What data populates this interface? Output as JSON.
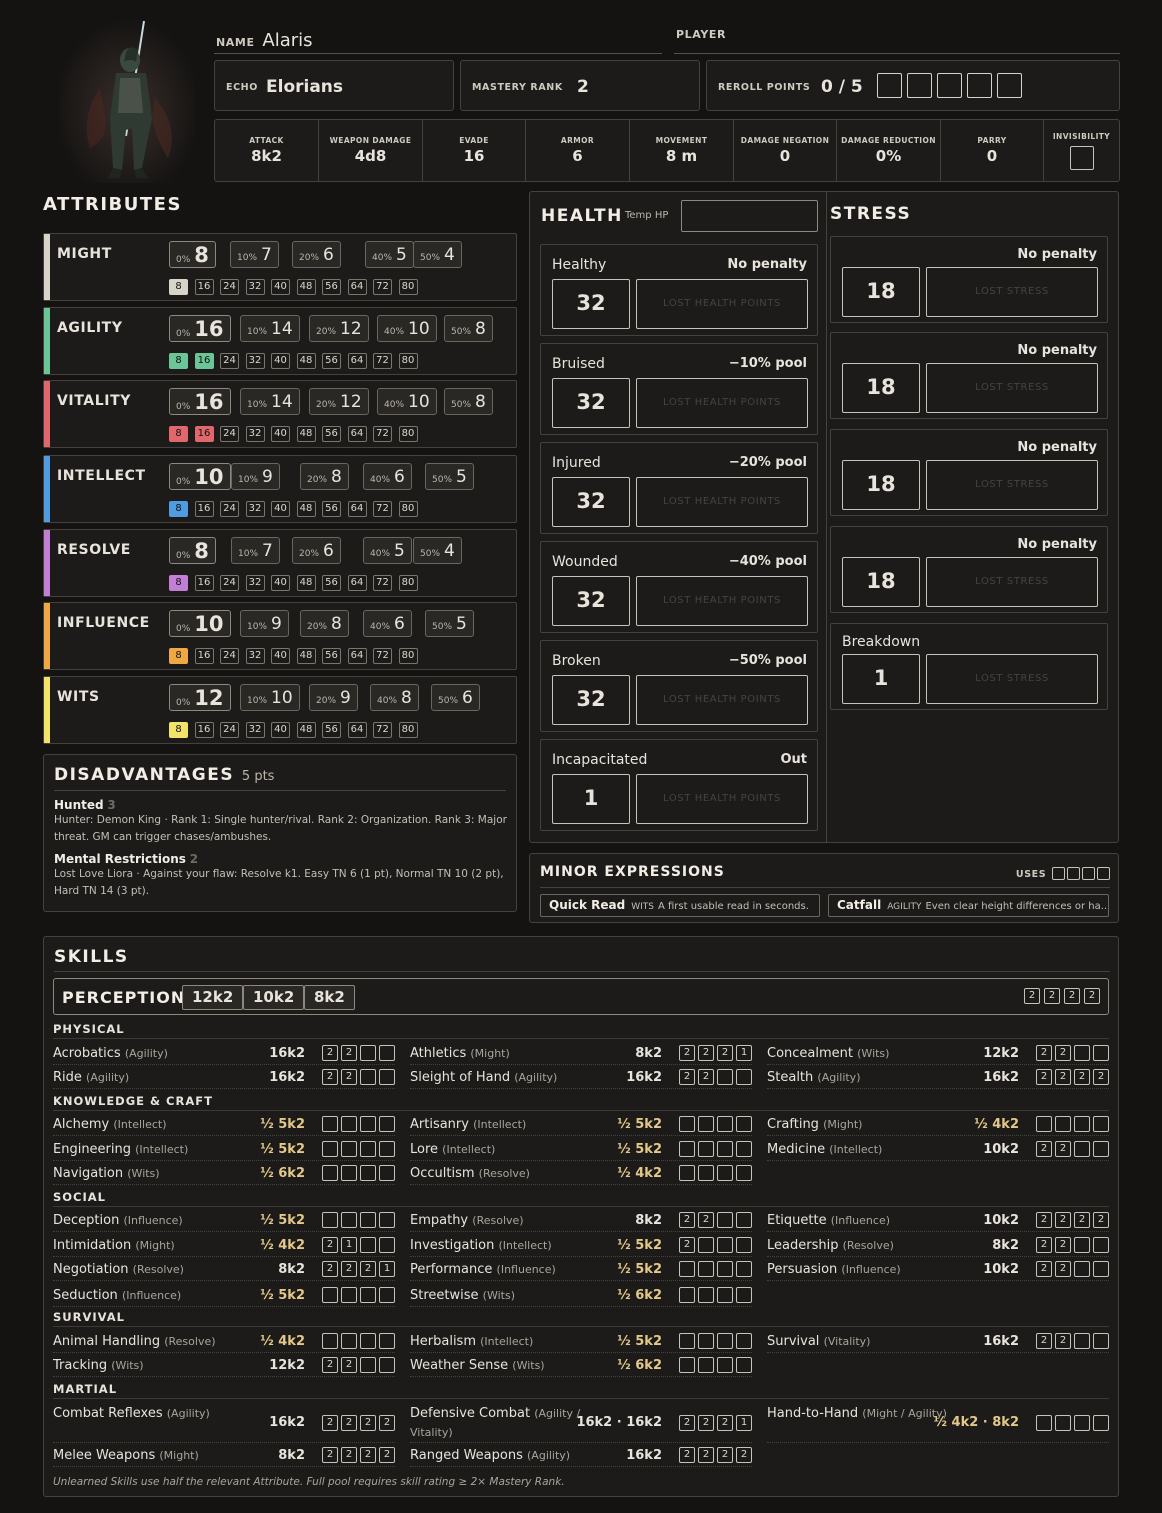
{
  "header": {
    "name_label": "NAME",
    "name": "Alaris",
    "player_label": "PLAYER",
    "player": "",
    "echo_label": "ECHO",
    "echo": "Elorians",
    "mastery_label": "MASTERY RANK",
    "mastery": "2",
    "reroll_label": "REROLL POINTS",
    "reroll": "0 / 5"
  },
  "stats": [
    {
      "label": "ATTACK",
      "value": "8k2"
    },
    {
      "label": "WEAPON DAMAGE",
      "value": "4d8"
    },
    {
      "label": "EVADE",
      "value": "16"
    },
    {
      "label": "ARMOR",
      "value": "6"
    },
    {
      "label": "MOVEMENT",
      "value": "8 m"
    },
    {
      "label": "DAMAGE NEGATION",
      "value": "0"
    },
    {
      "label": "DAMAGE REDUCTION",
      "value": "0%"
    },
    {
      "label": "PARRY",
      "value": "0"
    },
    {
      "label": "INVISIBILITY",
      "value": ""
    }
  ],
  "attributes_title": "ATTRIBUTES",
  "percent_labels": [
    "0%",
    "10%",
    "20%",
    "40%",
    "50%"
  ],
  "track": [
    "8",
    "16",
    "24",
    "32",
    "40",
    "48",
    "56",
    "64",
    "72",
    "80"
  ],
  "attributes": [
    {
      "name": "MIGHT",
      "color": "#d9d4c9",
      "values": [
        "8",
        "7",
        "6",
        "5",
        "4"
      ],
      "filled": 1
    },
    {
      "name": "AGILITY",
      "color": "#6cc596",
      "values": [
        "16",
        "14",
        "12",
        "10",
        "8"
      ],
      "filled": 2
    },
    {
      "name": "VITALITY",
      "color": "#e0676b",
      "values": [
        "16",
        "14",
        "12",
        "10",
        "8"
      ],
      "filled": 2
    },
    {
      "name": "INTELLECT",
      "color": "#4f9de0",
      "values": [
        "10",
        "9",
        "8",
        "6",
        "5"
      ],
      "filled": 1
    },
    {
      "name": "RESOLVE",
      "color": "#c37fd6",
      "values": [
        "8",
        "7",
        "6",
        "5",
        "4"
      ],
      "filled": 1
    },
    {
      "name": "INFLUENCE",
      "color": "#f0a845",
      "values": [
        "10",
        "9",
        "8",
        "6",
        "5"
      ],
      "filled": 1
    },
    {
      "name": "WITS",
      "color": "#f2e36a",
      "values": [
        "12",
        "10",
        "9",
        "8",
        "6"
      ],
      "filled": 1
    }
  ],
  "disadvantages": {
    "title": "DISADVANTAGES",
    "pts": "5 pts",
    "items": [
      {
        "name": "Hunted",
        "rank": "3",
        "desc": "Hunter: Demon King · Rank 1: Single hunter/rival. Rank 2: Organization. Rank 3: Major threat. GM can trigger chases/ambushes."
      },
      {
        "name": "Mental Restrictions",
        "rank": "2",
        "desc": "Lost Love Liora · Against your flaw: Resolve k1. Easy TN 6 (1 pt), Normal TN 10 (2 pt), Hard TN 14 (3 pt)."
      }
    ]
  },
  "health": {
    "title": "HEALTH",
    "temp_label": "Temp HP",
    "temp": "",
    "lost_label": "LOST HEALTH POINTS",
    "levels": [
      {
        "name": "Healthy",
        "penalty": "No penalty",
        "value": "32"
      },
      {
        "name": "Bruised",
        "penalty": "−10% pool",
        "value": "32"
      },
      {
        "name": "Injured",
        "penalty": "−20% pool",
        "value": "32"
      },
      {
        "name": "Wounded",
        "penalty": "−40% pool",
        "value": "32"
      },
      {
        "name": "Broken",
        "penalty": "−50% pool",
        "value": "32"
      },
      {
        "name": "Incapacitated",
        "penalty": "Out",
        "value": "1"
      }
    ]
  },
  "stress": {
    "title": "STRESS",
    "lost_label": "LOST STRESS",
    "levels": [
      {
        "name": "",
        "penalty": "No penalty",
        "value": "18"
      },
      {
        "name": "",
        "penalty": "No penalty",
        "value": "18"
      },
      {
        "name": "",
        "penalty": "No penalty",
        "value": "18"
      },
      {
        "name": "",
        "penalty": "No penalty",
        "value": "18"
      },
      {
        "name": "Breakdown",
        "penalty": "",
        "value": "1"
      }
    ]
  },
  "minor": {
    "title": "MINOR EXPRESSIONS",
    "uses_label": "USES",
    "items": [
      {
        "name": "Quick Read",
        "attr": "WITS",
        "desc": "A first usable read in seconds."
      },
      {
        "name": "Catfall",
        "attr": "AGILITY",
        "desc": "Even clear height differences or ha..."
      }
    ]
  },
  "skills": {
    "title": "SKILLS",
    "perception": {
      "label": "PERCEPTION",
      "pools": [
        "12k2",
        "10k2",
        "8k2"
      ],
      "ranks": [
        "2",
        "2",
        "2",
        "2"
      ]
    },
    "categories": [
      {
        "name": "PHYSICAL",
        "rows": [
          [
            {
              "name": "Acrobatics",
              "attr": "(Agility)",
              "pool": "16k2",
              "ranks": [
                "2",
                "2",
                "",
                ""
              ]
            },
            {
              "name": "Athletics",
              "attr": "(Might)",
              "pool": "8k2",
              "ranks": [
                "2",
                "2",
                "2",
                "1"
              ]
            },
            {
              "name": "Concealment",
              "attr": "(Wits)",
              "pool": "12k2",
              "ranks": [
                "2",
                "2",
                "",
                ""
              ]
            }
          ],
          [
            {
              "name": "Ride",
              "attr": "(Agility)",
              "pool": "16k2",
              "ranks": [
                "2",
                "2",
                "",
                ""
              ]
            },
            {
              "name": "Sleight of Hand",
              "attr": "(Agility)",
              "pool": "16k2",
              "ranks": [
                "2",
                "2",
                "",
                ""
              ]
            },
            {
              "name": "Stealth",
              "attr": "(Agility)",
              "pool": "16k2",
              "ranks": [
                "2",
                "2",
                "2",
                "2"
              ]
            }
          ]
        ]
      },
      {
        "name": "KNOWLEDGE & CRAFT",
        "rows": [
          [
            {
              "name": "Alchemy",
              "attr": "(Intellect)",
              "pool": "½ 5k2",
              "ranks": [
                "",
                "",
                "",
                ""
              ]
            },
            {
              "name": "Artisanry",
              "attr": "(Intellect)",
              "pool": "½ 5k2",
              "ranks": [
                "",
                "",
                "",
                ""
              ]
            },
            {
              "name": "Crafting",
              "attr": "(Might)",
              "pool": "½ 4k2",
              "ranks": [
                "",
                "",
                "",
                ""
              ]
            }
          ],
          [
            {
              "name": "Engineering",
              "attr": "(Intellect)",
              "pool": "½ 5k2",
              "ranks": [
                "",
                "",
                "",
                ""
              ]
            },
            {
              "name": "Lore",
              "attr": "(Intellect)",
              "pool": "½ 5k2",
              "ranks": [
                "",
                "",
                "",
                ""
              ]
            },
            {
              "name": "Medicine",
              "attr": "(Intellect)",
              "pool": "10k2",
              "ranks": [
                "2",
                "2",
                "",
                ""
              ]
            }
          ],
          [
            {
              "name": "Navigation",
              "attr": "(Wits)",
              "pool": "½ 6k2",
              "ranks": [
                "",
                "",
                "",
                ""
              ]
            },
            {
              "name": "Occultism",
              "attr": "(Resolve)",
              "pool": "½ 4k2",
              "ranks": [
                "",
                "",
                "",
                ""
              ]
            }
          ]
        ]
      },
      {
        "name": "SOCIAL",
        "rows": [
          [
            {
              "name": "Deception",
              "attr": "(Influence)",
              "pool": "½ 5k2",
              "ranks": [
                "",
                "",
                "",
                ""
              ]
            },
            {
              "name": "Empathy",
              "attr": "(Resolve)",
              "pool": "8k2",
              "ranks": [
                "2",
                "2",
                "",
                ""
              ]
            },
            {
              "name": "Etiquette",
              "attr": "(Influence)",
              "pool": "10k2",
              "ranks": [
                "2",
                "2",
                "2",
                "2"
              ]
            }
          ],
          [
            {
              "name": "Intimidation",
              "attr": "(Might)",
              "pool": "½ 4k2",
              "ranks": [
                "2",
                "1",
                "",
                ""
              ]
            },
            {
              "name": "Investigation",
              "attr": "(Intellect)",
              "pool": "½ 5k2",
              "ranks": [
                "2",
                "",
                "",
                ""
              ]
            },
            {
              "name": "Leadership",
              "attr": "(Resolve)",
              "pool": "8k2",
              "ranks": [
                "2",
                "2",
                "",
                ""
              ]
            }
          ],
          [
            {
              "name": "Negotiation",
              "attr": "(Resolve)",
              "pool": "8k2",
              "ranks": [
                "2",
                "2",
                "2",
                "1"
              ]
            },
            {
              "name": "Performance",
              "attr": "(Influence)",
              "pool": "½ 5k2",
              "ranks": [
                "",
                "",
                "",
                ""
              ]
            },
            {
              "name": "Persuasion",
              "attr": "(Influence)",
              "pool": "10k2",
              "ranks": [
                "2",
                "2",
                "",
                ""
              ]
            }
          ],
          [
            {
              "name": "Seduction",
              "attr": "(Influence)",
              "pool": "½ 5k2",
              "ranks": [
                "",
                "",
                "",
                ""
              ]
            },
            {
              "name": "Streetwise",
              "attr": "(Wits)",
              "pool": "½ 6k2",
              "ranks": [
                "",
                "",
                "",
                ""
              ]
            }
          ]
        ]
      },
      {
        "name": "SURVIVAL",
        "rows": [
          [
            {
              "name": "Animal Handling",
              "attr": "(Resolve)",
              "pool": "½ 4k2",
              "ranks": [
                "",
                "",
                "",
                ""
              ]
            },
            {
              "name": "Herbalism",
              "attr": "(Intellect)",
              "pool": "½ 5k2",
              "ranks": [
                "",
                "",
                "",
                ""
              ]
            },
            {
              "name": "Survival",
              "attr": "(Vitality)",
              "pool": "16k2",
              "ranks": [
                "2",
                "2",
                "",
                ""
              ]
            }
          ],
          [
            {
              "name": "Tracking",
              "attr": "(Wits)",
              "pool": "12k2",
              "ranks": [
                "2",
                "2",
                "",
                ""
              ]
            },
            {
              "name": "Weather Sense",
              "attr": "(Wits)",
              "pool": "½ 6k2",
              "ranks": [
                "",
                "",
                "",
                ""
              ]
            }
          ]
        ]
      },
      {
        "name": "MARTIAL",
        "rows": [
          [
            {
              "name": "Combat Reflexes",
              "attr": "(Agility)",
              "pool": "16k2",
              "ranks": [
                "2",
                "2",
                "2",
                "2"
              ]
            },
            {
              "name": "Defensive Combat",
              "attr": "(Agility / Vitality)",
              "pool": "16k2 · 16k2",
              "ranks": [
                "2",
                "2",
                "2",
                "1"
              ]
            },
            {
              "name": "Hand-to-Hand",
              "attr": "(Might / Agility)",
              "pool": "½ 4k2 · 8k2",
              "ranks": [
                "",
                "",
                "",
                ""
              ]
            }
          ],
          [
            {
              "name": "Melee Weapons",
              "attr": "(Might)",
              "pool": "8k2",
              "ranks": [
                "2",
                "2",
                "2",
                "2"
              ]
            },
            {
              "name": "Ranged Weapons",
              "attr": "(Agility)",
              "pool": "16k2",
              "ranks": [
                "2",
                "2",
                "2",
                "2"
              ]
            }
          ]
        ]
      }
    ],
    "footnote": "Unlearned Skills use half the relevant Attribute. Full pool requires skill rating ≥ 2× Mastery Rank."
  }
}
